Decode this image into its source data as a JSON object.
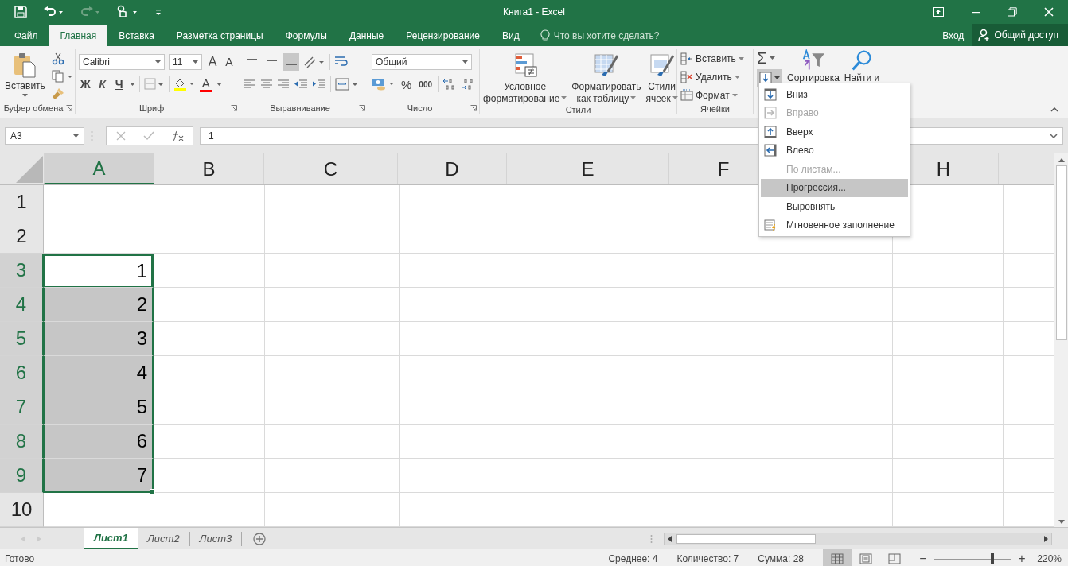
{
  "title_bar": {
    "title": "Книга1 - Excel"
  },
  "tabs": [
    {
      "label": "Файл",
      "selected": false
    },
    {
      "label": "Главная",
      "selected": true
    },
    {
      "label": "Вставка",
      "selected": false
    },
    {
      "label": "Разметка страницы",
      "selected": false
    },
    {
      "label": "Формулы",
      "selected": false
    },
    {
      "label": "Данные",
      "selected": false
    },
    {
      "label": "Рецензирование",
      "selected": false
    },
    {
      "label": "Вид",
      "selected": false
    }
  ],
  "tell_me": {
    "placeholder": "Что вы хотите сделать?"
  },
  "account": {
    "sign_in": "Вход",
    "share": "Общий доступ"
  },
  "ribbon": {
    "clipboard": {
      "paste": "Вставить",
      "label": "Буфер обмена"
    },
    "font": {
      "name": "Calibri",
      "size": "11",
      "grow": "A",
      "shrink": "A",
      "bold": "Ж",
      "italic": "К",
      "underline": "Ч",
      "color_button": "A",
      "label": "Шрифт"
    },
    "alignment": {
      "valign_buttons": [
        {
          "kind": "top",
          "selected": false
        },
        {
          "kind": "middle",
          "selected": false
        },
        {
          "kind": "bottom",
          "selected": true
        }
      ],
      "label": "Выравнивание"
    },
    "number": {
      "format": "Общий",
      "percent": "%",
      "thousands": "000",
      "label": "Число"
    },
    "styles": {
      "buttons": [
        {
          "kind": "conditional",
          "line1": "Условное",
          "line2": "форматирование"
        },
        {
          "kind": "table",
          "line1": "Форматировать",
          "line2": "как таблицу"
        },
        {
          "kind": "cell",
          "line1": "Стили",
          "line2": "ячеек"
        }
      ],
      "label": "Стили"
    },
    "cells": {
      "buttons": [
        {
          "kind": "insert",
          "label": "Вставить"
        },
        {
          "kind": "delete",
          "label": "Удалить"
        },
        {
          "kind": "format",
          "label": "Формат"
        }
      ],
      "label": "Ячейки"
    },
    "editing": {
      "sum": "Σ",
      "fill_open": true,
      "sort": "Сортировка",
      "find": "Найти и"
    }
  },
  "fill_menu": [
    {
      "kind": "down",
      "label": "Вниз",
      "disabled": false,
      "selected": false
    },
    {
      "kind": "right",
      "label": "Вправо",
      "disabled": true,
      "selected": false
    },
    {
      "kind": "up",
      "label": "Вверх",
      "disabled": false,
      "selected": false
    },
    {
      "kind": "left",
      "label": "Влево",
      "disabled": false,
      "selected": false
    },
    {
      "kind": "plain",
      "label": "По листам...",
      "disabled": true,
      "selected": false
    },
    {
      "kind": "plain",
      "label": "Прогрессия...",
      "disabled": false,
      "selected": true
    },
    {
      "kind": "plain",
      "label": "Выровнять",
      "disabled": false,
      "selected": false
    },
    {
      "kind": "flash",
      "label": "Мгновенное заполнение",
      "disabled": false,
      "selected": false
    }
  ],
  "formula_bar": {
    "name_box": "A3",
    "formula": "1"
  },
  "sheet": {
    "columns": [
      {
        "label": "A",
        "selected": true
      },
      {
        "label": "B",
        "selected": false
      },
      {
        "label": "C",
        "selected": false
      },
      {
        "label": "D",
        "selected": false
      },
      {
        "label": "E",
        "selected": false
      },
      {
        "label": "F",
        "selected": false
      },
      {
        "label": "H",
        "selected": false
      }
    ],
    "rows": [
      {
        "number": "1",
        "selected": false,
        "active": false
      },
      {
        "number": "2",
        "selected": false,
        "active": false
      },
      {
        "number": "3",
        "value": "1",
        "selected": true,
        "active": true
      },
      {
        "number": "4",
        "value": "2",
        "selected": true,
        "active": false
      },
      {
        "number": "5",
        "value": "3",
        "selected": true,
        "active": false
      },
      {
        "number": "6",
        "value": "4",
        "selected": true,
        "active": false
      },
      {
        "number": "7",
        "value": "5",
        "selected": true,
        "active": false
      },
      {
        "number": "8",
        "value": "6",
        "selected": true,
        "active": false
      },
      {
        "number": "9",
        "value": "7",
        "selected": true,
        "active": false
      },
      {
        "number": "10",
        "selected": false,
        "active": false
      }
    ]
  },
  "sheet_tabs": [
    {
      "label": "Лист1",
      "selected": true
    },
    {
      "label": "Лист2",
      "selected": false
    },
    {
      "label": "Лист3",
      "selected": false
    }
  ],
  "status_bar": {
    "status": "Готово",
    "average": "Среднее: 4",
    "count": "Количество: 7",
    "sum": "Сумма: 28",
    "views": [
      {
        "kind": "normal",
        "selected": true
      },
      {
        "kind": "page_layout",
        "selected": false
      },
      {
        "kind": "page_break",
        "selected": false
      }
    ],
    "zoom": {
      "minus": "−",
      "plus": "+",
      "level": 0.76,
      "reading": "220%"
    }
  }
}
